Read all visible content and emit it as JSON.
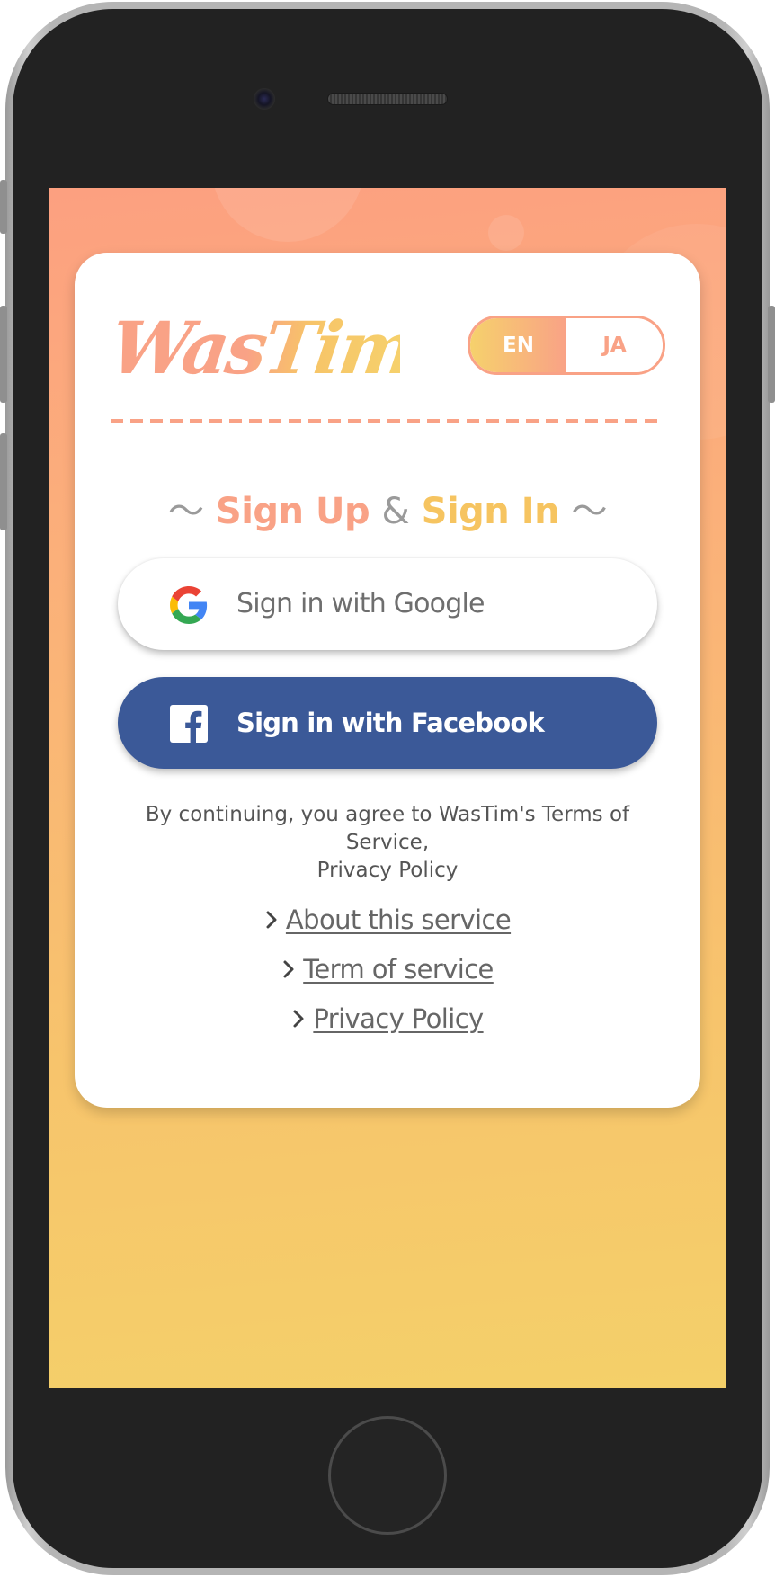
{
  "brand": {
    "logo_text": "WasTim",
    "logo_left": "Was",
    "logo_right": "Tim"
  },
  "language": {
    "options": [
      "EN",
      "JA"
    ],
    "selected": "EN"
  },
  "heading": {
    "tilde_left": "〜",
    "sign_up": "Sign Up",
    "amp": "&",
    "sign_in": "Sign In",
    "tilde_right": "〜"
  },
  "buttons": {
    "google": {
      "label": "Sign in with Google",
      "icon": "google-icon"
    },
    "facebook": {
      "label": "Sign in with Facebook",
      "icon": "facebook-icon"
    }
  },
  "agreement": {
    "line1": "By continuing, you agree to WasTim's Terms of Service,",
    "line2": "Privacy Policy"
  },
  "links": [
    {
      "label": "About this service",
      "icon": "chevron-right-icon"
    },
    {
      "label": "Term of service",
      "icon": "chevron-right-icon"
    },
    {
      "label": "Privacy Policy",
      "icon": "chevron-right-icon"
    }
  ],
  "colors": {
    "accent_salmon": "#f9a286",
    "accent_yellow": "#f6c460",
    "facebook_blue": "#3b5998",
    "text_gray": "#666666"
  }
}
